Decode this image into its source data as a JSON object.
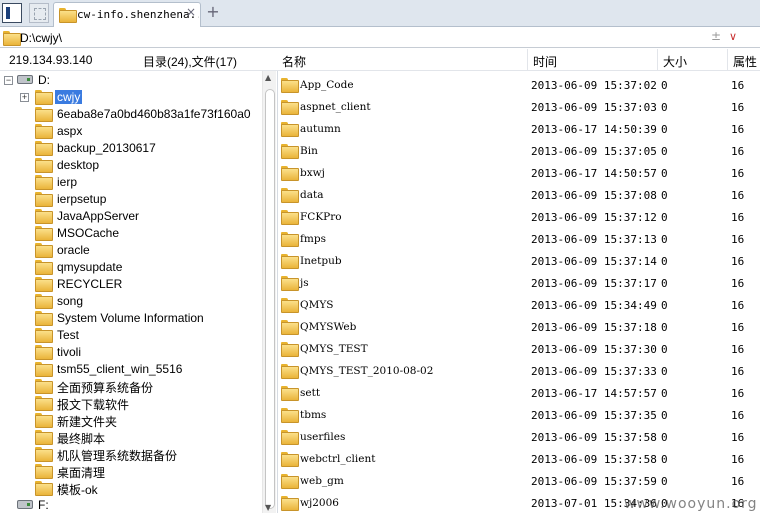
{
  "tabbar": {
    "tab_label": "cw-info.shenzhena...",
    "close_glyph": "×",
    "add_glyph": "+"
  },
  "address": {
    "path": "D:\\cwjy\\",
    "plusminus_glyph": "±",
    "dropdown_glyph": "∨"
  },
  "header": {
    "ip": "219.134.93.140",
    "summary": "目录(24),文件(17)",
    "col_name": "名称",
    "col_time": "时间",
    "col_size": "大小",
    "col_attr": "属性"
  },
  "tree": {
    "drive_d": "D:",
    "drive_f": "F:",
    "selected": "cwjy",
    "expand_glyph": "+",
    "collapse_glyph": "−",
    "folders": [
      "6eaba8e7a0bd460b83a1fe73f160a0",
      "aspx",
      "backup_20130617",
      "desktop",
      "ierp",
      "ierpsetup",
      "JavaAppServer",
      "MSOCache",
      "oracle",
      "qmysupdate",
      "RECYCLER",
      "song",
      "System Volume Information",
      "Test",
      "tivoli",
      "tsm55_client_win_5516",
      "全面预算系统备份",
      "报文下载软件",
      "新建文件夹",
      "最终脚本",
      "机队管理系统数据备份",
      "桌面清理",
      "模板-ok"
    ]
  },
  "files": [
    {
      "name": "App_Code",
      "time": "2013-06-09 15:37:02",
      "size": "0",
      "attr": "16"
    },
    {
      "name": "aspnet_client",
      "time": "2013-06-09 15:37:03",
      "size": "0",
      "attr": "16"
    },
    {
      "name": "autumn",
      "time": "2013-06-17 14:50:39",
      "size": "0",
      "attr": "16"
    },
    {
      "name": "Bin",
      "time": "2013-06-09 15:37:05",
      "size": "0",
      "attr": "16"
    },
    {
      "name": "bxwj",
      "time": "2013-06-17 14:50:57",
      "size": "0",
      "attr": "16"
    },
    {
      "name": "data",
      "time": "2013-06-09 15:37:08",
      "size": "0",
      "attr": "16"
    },
    {
      "name": "FCKPro",
      "time": "2013-06-09 15:37:12",
      "size": "0",
      "attr": "16"
    },
    {
      "name": "fmps",
      "time": "2013-06-09 15:37:13",
      "size": "0",
      "attr": "16"
    },
    {
      "name": "Inetpub",
      "time": "2013-06-09 15:37:14",
      "size": "0",
      "attr": "16"
    },
    {
      "name": "js",
      "time": "2013-06-09 15:37:17",
      "size": "0",
      "attr": "16"
    },
    {
      "name": "QMYS",
      "time": "2013-06-09 15:34:49",
      "size": "0",
      "attr": "16"
    },
    {
      "name": "QMYSWeb",
      "time": "2013-06-09 15:37:18",
      "size": "0",
      "attr": "16"
    },
    {
      "name": "QMYS_TEST",
      "time": "2013-06-09 15:37:30",
      "size": "0",
      "attr": "16"
    },
    {
      "name": "QMYS_TEST_2010-08-02",
      "time": "2013-06-09 15:37:33",
      "size": "0",
      "attr": "16"
    },
    {
      "name": "sett",
      "time": "2013-06-17 14:57:57",
      "size": "0",
      "attr": "16"
    },
    {
      "name": "tbms",
      "time": "2013-06-09 15:37:35",
      "size": "0",
      "attr": "16"
    },
    {
      "name": "userfiles",
      "time": "2013-06-09 15:37:58",
      "size": "0",
      "attr": "16"
    },
    {
      "name": "webctrl_client",
      "time": "2013-06-09 15:37:58",
      "size": "0",
      "attr": "16"
    },
    {
      "name": "web_gm",
      "time": "2013-06-09 15:37:59",
      "size": "0",
      "attr": "16"
    },
    {
      "name": "wj2006",
      "time": "2013-07-01 15:34:36",
      "size": "0",
      "attr": "16"
    }
  ],
  "watermark": "www.wooyun.org"
}
